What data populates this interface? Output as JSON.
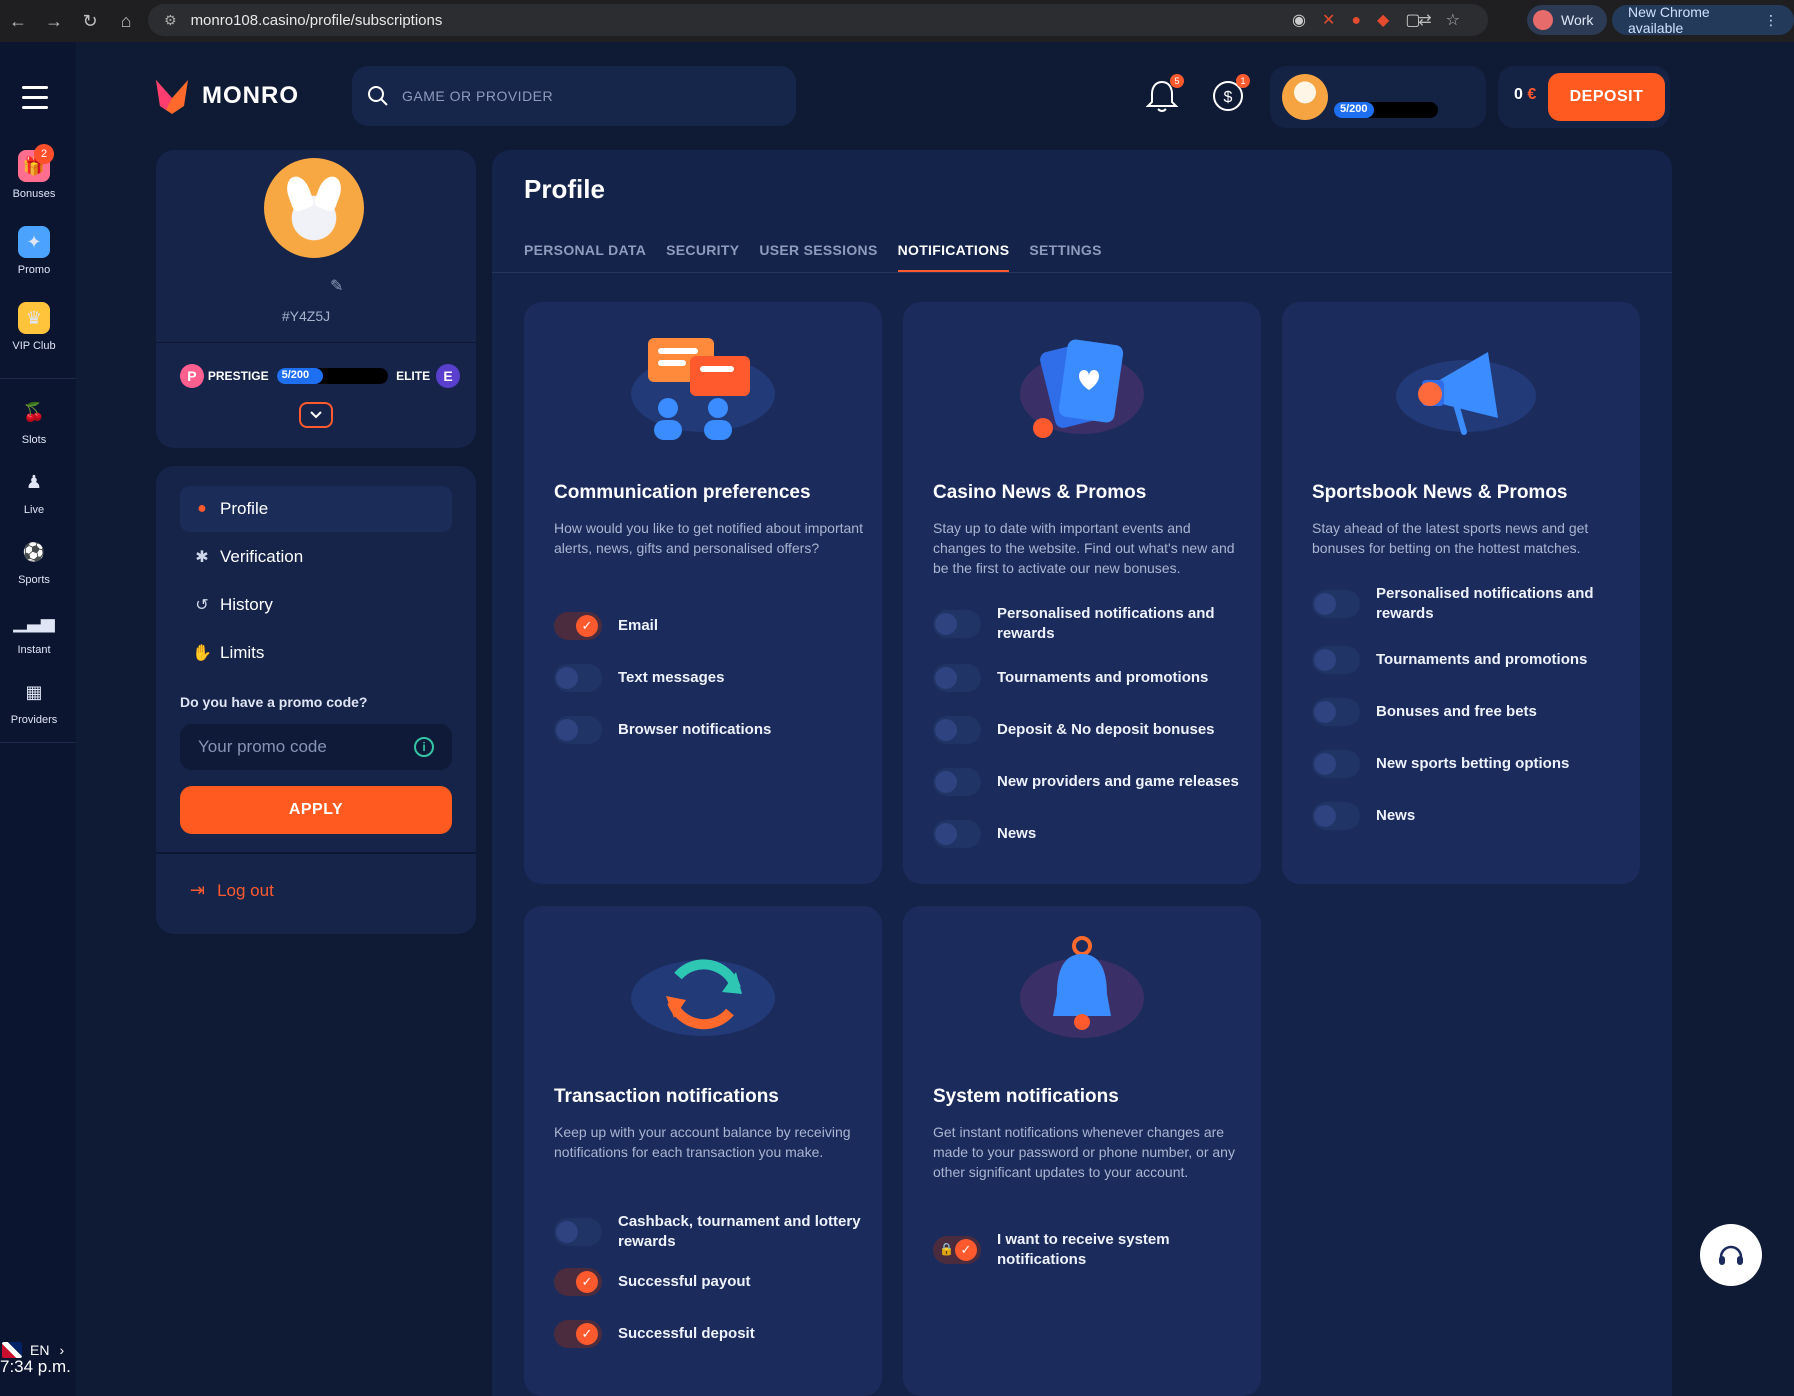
{
  "browser": {
    "url": "monro108.casino/profile/subscriptions",
    "profile_label": "Work",
    "update_label": "New Chrome available"
  },
  "rail": {
    "items": [
      {
        "label": "Bonuses",
        "badge": "2"
      },
      {
        "label": "Promo"
      },
      {
        "label": "VIP Club"
      },
      {
        "label": "Slots"
      },
      {
        "label": "Live"
      },
      {
        "label": "Sports"
      },
      {
        "label": "Instant"
      },
      {
        "label": "Providers"
      }
    ],
    "language": "EN",
    "time": "7:34 p.m."
  },
  "header": {
    "brand": "MONRO",
    "search_placeholder": "GAME OR PROVIDER",
    "notif_badge": "5",
    "cashback_badge": "1",
    "level": "5/200",
    "balance": "0",
    "currency": "€",
    "deposit_label": "DEPOSIT"
  },
  "profile_card": {
    "user_id": "#Y4Z5J",
    "current_tier": "PRESTIGE",
    "current_tier_letter": "P",
    "progress": "5/200",
    "next_tier": "ELITE",
    "next_tier_letter": "E"
  },
  "menu": {
    "items": [
      {
        "label": "Profile",
        "icon": "user-icon"
      },
      {
        "label": "Verification",
        "icon": "gear-icon"
      },
      {
        "label": "History",
        "icon": "history-icon"
      },
      {
        "label": "Limits",
        "icon": "hand-icon"
      }
    ],
    "promo_question": "Do you have a promo code?",
    "promo_placeholder": "Your promo code",
    "apply_label": "APPLY",
    "logout_label": "Log out"
  },
  "main": {
    "title": "Profile",
    "tabs": [
      "PERSONAL DATA",
      "SECURITY",
      "USER SESSIONS",
      "NOTIFICATIONS",
      "SETTINGS"
    ],
    "active_tab": "NOTIFICATIONS"
  },
  "cards": {
    "communication": {
      "title": "Communication preferences",
      "desc": "How would you like to get notified about important alerts, news, gifts and personalised offers?",
      "options": [
        {
          "label": "Email",
          "on": true
        },
        {
          "label": "Text messages",
          "on": false
        },
        {
          "label": "Browser notifications",
          "on": false
        }
      ]
    },
    "casino": {
      "title": "Casino News & Promos",
      "desc": "Stay up to date with important events and changes to the website. Find out what's new and be the first to activate our new bonuses.",
      "options": [
        {
          "label": "Personalised notifications and rewards",
          "on": false
        },
        {
          "label": "Tournaments and promotions",
          "on": false
        },
        {
          "label": "Deposit & No deposit bonuses",
          "on": false
        },
        {
          "label": "New providers and game releases",
          "on": false
        },
        {
          "label": "News",
          "on": false
        }
      ]
    },
    "sportsbook": {
      "title": "Sportsbook News & Promos",
      "desc": "Stay ahead of the latest sports news and get bonuses for betting on the hottest matches.",
      "options": [
        {
          "label": "Personalised notifications and rewards",
          "on": false
        },
        {
          "label": "Tournaments and promotions",
          "on": false
        },
        {
          "label": "Bonuses and free bets",
          "on": false
        },
        {
          "label": "New sports betting options",
          "on": false
        },
        {
          "label": "News",
          "on": false
        }
      ]
    },
    "transaction": {
      "title": "Transaction notifications",
      "desc": "Keep up with your account balance by receiving notifications for each transaction you make.",
      "options": [
        {
          "label": "Cashback, tournament and lottery rewards",
          "on": false
        },
        {
          "label": "Successful payout",
          "on": true
        },
        {
          "label": "Successful deposit",
          "on": true
        }
      ]
    },
    "system": {
      "title": "System notifications",
      "desc": "Get instant notifications whenever changes are made to your password or phone number, or any other significant updates to your account.",
      "options": [
        {
          "label": "I want to receive system notifications",
          "on": true,
          "locked": true
        }
      ]
    }
  }
}
